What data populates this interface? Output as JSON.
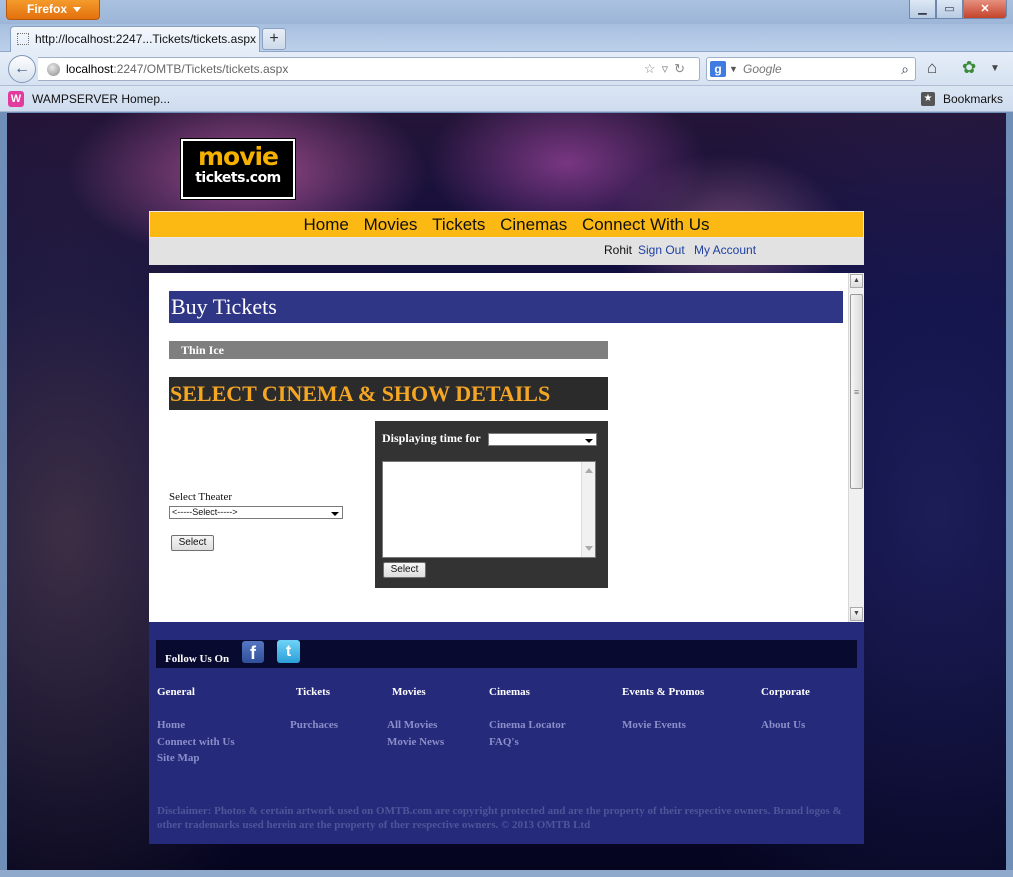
{
  "browser": {
    "app_button": "Firefox",
    "tab_title": "http://localhost:2247...Tickets/tickets.aspx",
    "url_host": "localhost",
    "url_rest": ":2247/OMTB/Tickets/tickets.aspx",
    "search_placeholder": "Google",
    "bookmark_item": "WAMPSERVER Homep...",
    "bookmarks_label": "Bookmarks"
  },
  "site": {
    "logo_line1": "movie",
    "logo_line2": "tickets.com",
    "menu": [
      "Home",
      "Movies",
      "Tickets",
      "Cinemas",
      "Connect With Us"
    ],
    "user": {
      "name": "Rohit",
      "sign_out": "Sign Out",
      "account": "My Account"
    }
  },
  "booking": {
    "page_heading": "Buy Tickets",
    "movie_title": "Thin Ice",
    "section_heading": "SELECT CINEMA & SHOW DETAILS",
    "theater_label": "Select Theater",
    "theater_selected": "<-----Select----->",
    "select_button": "Select",
    "time_label": "Displaying time for",
    "time_selected": "",
    "time_select_button": "Select"
  },
  "footer": {
    "follow_label": "Follow Us On",
    "facebook_glyph": "f",
    "twitter_glyph": "t",
    "columns": [
      {
        "heading": "General",
        "links": [
          "Home",
          "Connect with Us",
          "Site Map"
        ]
      },
      {
        "heading": "Tickets",
        "links": [
          "Purchaces"
        ]
      },
      {
        "heading": "Movies",
        "links": [
          "All Movies",
          "Movie News"
        ]
      },
      {
        "heading": "Cinemas",
        "links": [
          "Cinema Locator",
          "FAQ's"
        ]
      },
      {
        "heading": "Events & Promos",
        "links": [
          "Movie Events"
        ]
      },
      {
        "heading": "Corporate",
        "links": [
          "About Us"
        ]
      }
    ],
    "disclaimer": "Disclaimer: Photos & certain artwork used on OMTB.com are copyright protected and are the property of their respective owners. Brand logos & other trademarks used herein are the property of ther respective owners. © 2013 OMTB Ltd"
  },
  "colors": {
    "menu_bar": "#fdb913",
    "heading_bar": "#2f3686",
    "section_heading_text": "#f5a623",
    "footer_bg": "#262a7a"
  }
}
